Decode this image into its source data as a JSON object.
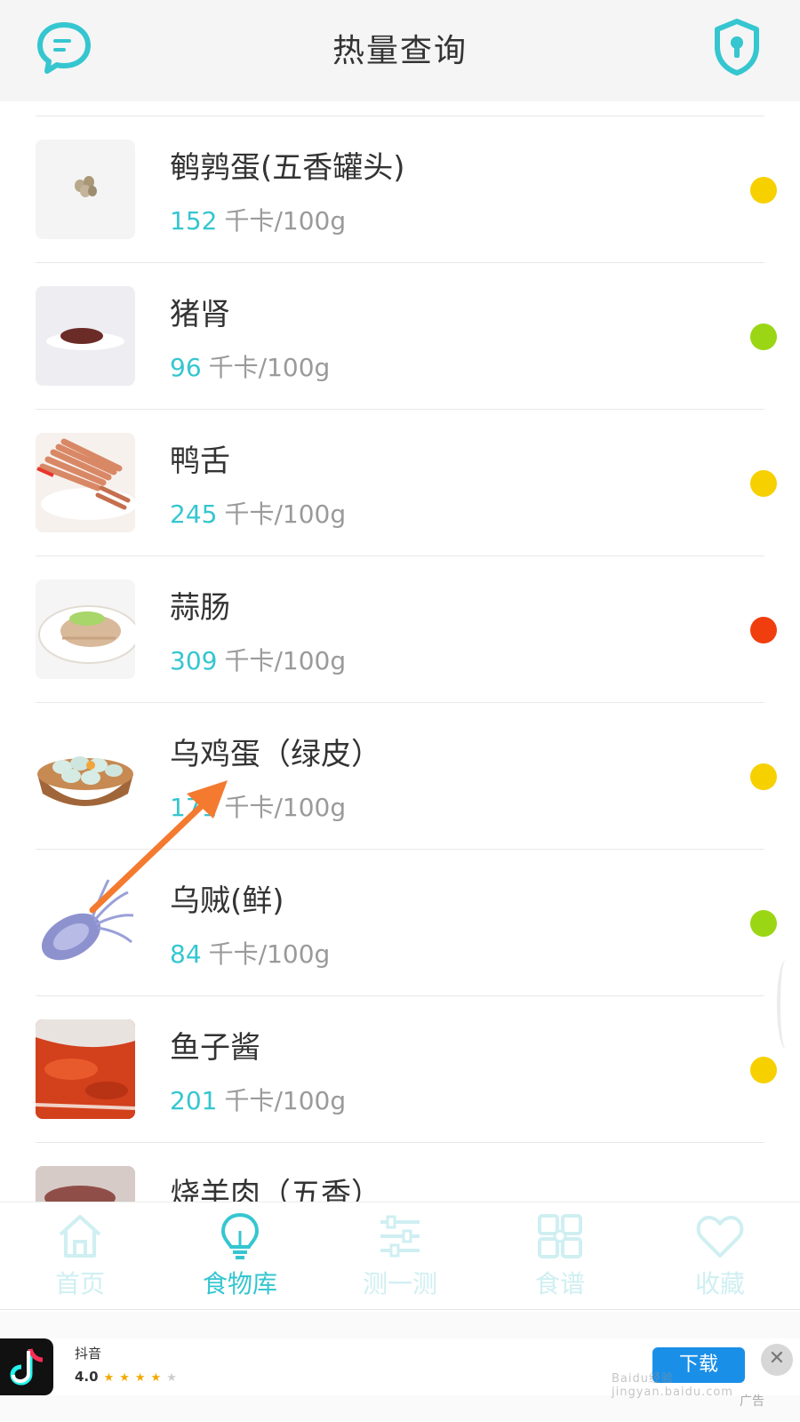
{
  "header": {
    "title": "热量查询",
    "left_icon": "chat-bubble-icon",
    "right_icon": "shield-keyhole-icon",
    "accent": "#35c6d0"
  },
  "food_list": {
    "unit": "千卡/100g",
    "items": [
      {
        "name": "鹌鹑蛋(五香罐头)",
        "calories": "152",
        "level_color": "#f7d000"
      },
      {
        "name": "猪肾",
        "calories": "96",
        "level_color": "#9bd615"
      },
      {
        "name": "鸭舌",
        "calories": "245",
        "level_color": "#f7d000"
      },
      {
        "name": "蒜肠",
        "calories": "309",
        "level_color": "#f03e0f"
      },
      {
        "name": "乌鸡蛋（绿皮）",
        "calories": "171",
        "level_color": "#f7d000"
      },
      {
        "name": "乌贼(鲜)",
        "calories": "84",
        "level_color": "#9bd615"
      },
      {
        "name": "鱼子酱",
        "calories": "201",
        "level_color": "#f7d000"
      },
      {
        "name": "烧羊肉（五香）",
        "calories": "",
        "level_color": ""
      }
    ]
  },
  "tabs": [
    {
      "label": "首页",
      "icon": "home-icon",
      "active": false
    },
    {
      "label": "食物库",
      "icon": "lightbulb-icon",
      "active": true
    },
    {
      "label": "测一测",
      "icon": "sliders-icon",
      "active": false
    },
    {
      "label": "食谱",
      "icon": "grid-icon",
      "active": false
    },
    {
      "label": "收藏",
      "icon": "heart-icon",
      "active": false
    }
  ],
  "ad": {
    "app_name": "抖音",
    "rating": "4.0",
    "stars": "★★★★",
    "star_off": "★",
    "button_label": "下载",
    "mark": "广告",
    "close": "✕"
  },
  "watermark": "Baidu经验 jingyan.baidu.com",
  "annotation": {
    "color": "#f47a2f"
  }
}
